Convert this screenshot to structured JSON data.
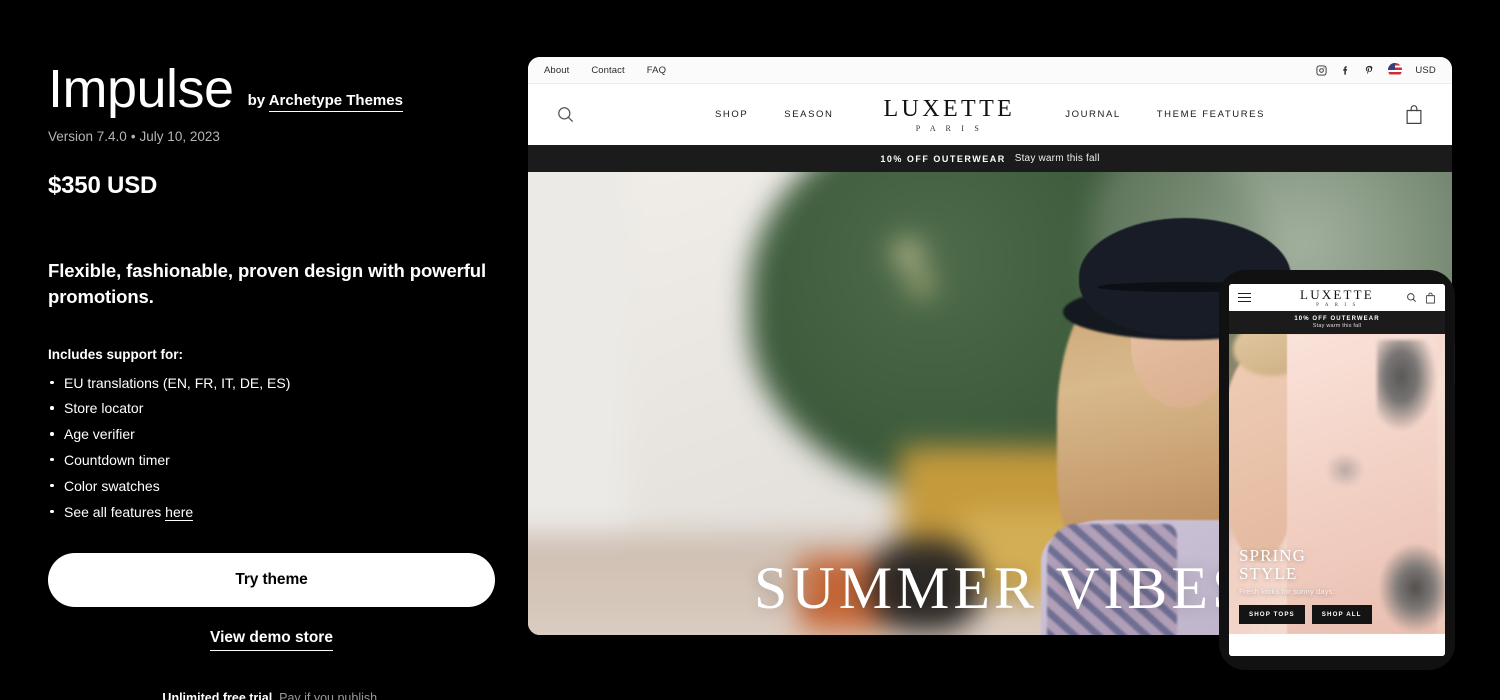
{
  "theme": {
    "name": "Impulse",
    "by_prefix": "by ",
    "author": "Archetype Themes",
    "version_line": "Version 7.4.0",
    "separator": "•",
    "date": "July 10, 2023",
    "price": "$350 USD",
    "tagline": "Flexible, fashionable, proven design with powerful promotions.",
    "includes_label": "Includes support for:",
    "features": [
      {
        "text": "EU translations (EN, FR, IT, DE, ES)"
      },
      {
        "text": "Store locator"
      },
      {
        "text": "Age verifier"
      },
      {
        "text": "Countdown timer"
      },
      {
        "text": "Color swatches"
      },
      {
        "text": "See all features ",
        "link": "here"
      }
    ],
    "try_button": "Try theme",
    "demo_link": "View demo store",
    "trial_strong": "Unlimited free trial",
    "trial_rest": ". Pay if you publish."
  },
  "preview": {
    "utility_bar": {
      "links": [
        "About",
        "Contact",
        "FAQ"
      ],
      "social": [
        "instagram-icon",
        "facebook-icon",
        "pinterest-icon"
      ],
      "currency": "USD",
      "flag": "us-flag-icon"
    },
    "nav": {
      "search_icon": "search-icon",
      "left_links": [
        "SHOP",
        "SEASON"
      ],
      "brand_name": "LUXETTE",
      "brand_sub": "P A R I S",
      "right_links": [
        "JOURNAL",
        "THEME FEATURES"
      ],
      "cart_icon": "shopping-bag-icon"
    },
    "promo": {
      "strong": "10% OFF OUTERWEAR",
      "text": "Stay warm this fall"
    },
    "hero": {
      "headline": "SUMMER VIBES"
    }
  },
  "phone": {
    "header": {
      "menu_icon": "hamburger-menu-icon",
      "brand_name": "LUXETTE",
      "brand_sub": "P A R I S",
      "search_icon": "search-icon",
      "cart_icon": "shopping-bag-icon"
    },
    "promo": {
      "strong": "10% OFF OUTERWEAR",
      "text": "Stay warm this fall"
    },
    "hero": {
      "line1": "SPRING",
      "line2": "STYLE",
      "subtitle": "Fresh looks for sunny days.",
      "buttons": [
        "SHOP TOPS",
        "SHOP ALL"
      ]
    }
  },
  "colors": {
    "background": "#000000",
    "text": "#ffffff",
    "muted": "#b5b5b5",
    "button_bg": "#ffffff",
    "promo_bar": "#1b1b1b"
  }
}
